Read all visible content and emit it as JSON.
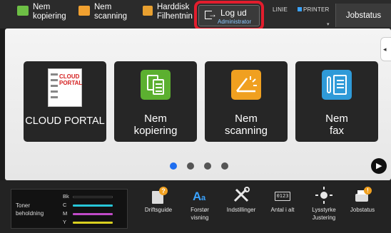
{
  "topbar": {
    "items": [
      {
        "line1": "Nem",
        "line2": "kopiering",
        "icon": "copy-icon",
        "color": "#6dbf45"
      },
      {
        "line1": "Nem",
        "line2": "scanning",
        "icon": "scan-icon",
        "color": "#f0a030"
      },
      {
        "line1": "Harddisk",
        "line2": "Filhentnin",
        "icon": "harddisk-folder-icon",
        "color": "#e8a030"
      }
    ],
    "logout": {
      "label": "Log ud",
      "sublabel": "Administrator"
    },
    "status_line": "LINIE",
    "status_printer": "PRINTER",
    "jobstatus": "Jobstatus",
    "highlight_color": "#e21d2d"
  },
  "main": {
    "tiles": [
      {
        "label": "CLOUD PORTAL",
        "icon": "cloud-portal-icon",
        "badge_line1": "CLOUD",
        "badge_line2": "PORTAL"
      },
      {
        "label": "Nem\nkopiering",
        "line1": "Nem",
        "line2": "kopiering",
        "icon": "copy-icon",
        "color": "#5cb030"
      },
      {
        "label": "Nem\nscanning",
        "line1": "Nem",
        "line2": "scanning",
        "icon": "scan-icon",
        "color": "#f0a020"
      },
      {
        "label": "Nem\nfax",
        "line1": "Nem",
        "line2": "fax",
        "icon": "fax-icon",
        "color": "#2f9ad8"
      }
    ],
    "page_dots": 4,
    "active_page": 1
  },
  "bottom": {
    "toner": {
      "title_line1": "Toner",
      "title_line2": "beholdning",
      "rows": [
        {
          "label": "Bk",
          "color": "#000000"
        },
        {
          "label": "C",
          "color": "#27c6d8"
        },
        {
          "label": "M",
          "color": "#c04bc8"
        },
        {
          "label": "Y",
          "color": "#d9d020"
        }
      ]
    },
    "icons": [
      {
        "label1": "Driftsguide",
        "label2": "",
        "icon": "operation-guide-icon"
      },
      {
        "label1": "Forstør",
        "label2": "visning",
        "icon": "magnify-display-icon"
      },
      {
        "label1": "Indstillinger",
        "label2": "",
        "icon": "settings-tools-icon"
      },
      {
        "label1": "Antal i alt",
        "label2": "",
        "icon": "total-count-icon"
      },
      {
        "label1": "Lysstyrke",
        "label2": "Justering",
        "icon": "brightness-icon"
      },
      {
        "label1": "Jobstatus",
        "label2": "",
        "icon": "job-status-icon"
      }
    ]
  }
}
